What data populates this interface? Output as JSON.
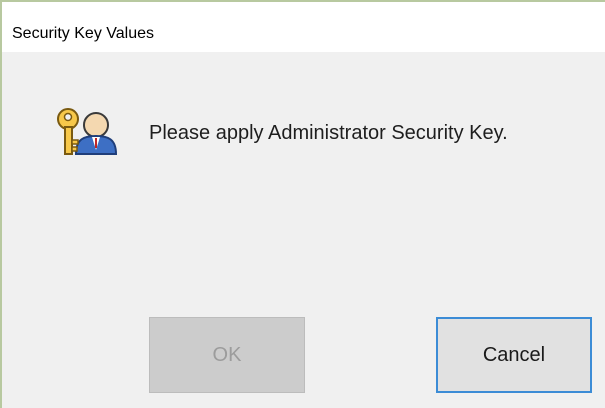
{
  "dialog": {
    "title": "Security Key Values",
    "message": "Please apply Administrator Security Key.",
    "icon": "key-user-icon"
  },
  "buttons": {
    "ok_label": "OK",
    "ok_enabled": false,
    "cancel_label": "Cancel"
  }
}
